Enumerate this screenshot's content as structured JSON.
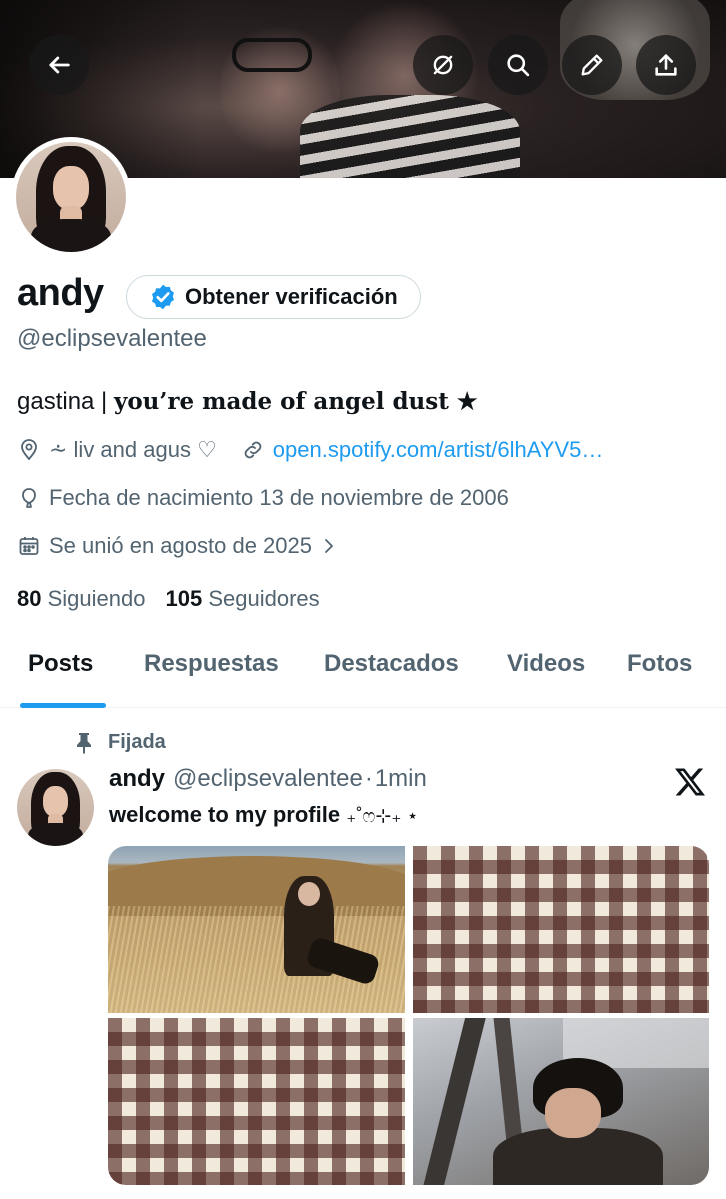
{
  "header": {
    "back_icon": "arrow-left-icon",
    "action_icons": [
      "hide-icon",
      "search-icon",
      "edit-icon",
      "share-icon"
    ]
  },
  "profile": {
    "name": "andy",
    "verify_button_label": "Obtener verificación",
    "handle": "@eclipsevalentee",
    "bio_plain": "gastina | ",
    "bio_styled": "you’re made of angel dust ★",
    "location": "⩪ liv and agus ♡",
    "website": "open.spotify.com/artist/6lhAYV5…",
    "birthday": "Fecha de nacimiento 13 de noviembre de 2006",
    "joined": "Se unió en agosto de 2025",
    "following_count": "80",
    "following_label": "Siguiendo",
    "followers_count": "105",
    "followers_label": "Seguidores"
  },
  "tabs": [
    {
      "label": "Posts",
      "active": true
    },
    {
      "label": "Respuestas",
      "active": false
    },
    {
      "label": "Destacados",
      "active": false
    },
    {
      "label": "Videos",
      "active": false
    },
    {
      "label": "Fotos",
      "active": false
    }
  ],
  "post": {
    "pinned_label": "Fijada",
    "author_name": "andy",
    "author_handle": "@eclipsevalentee",
    "separator": "·",
    "time": "1min",
    "text": "welcome to my profile",
    "text_deco": "₊˚ෆ⊹₊ ⋆",
    "media_count": 4
  },
  "colors": {
    "accent": "#1d9bf0",
    "text_primary": "#0f1419",
    "text_secondary": "#536471",
    "border": "#cfd9de"
  }
}
